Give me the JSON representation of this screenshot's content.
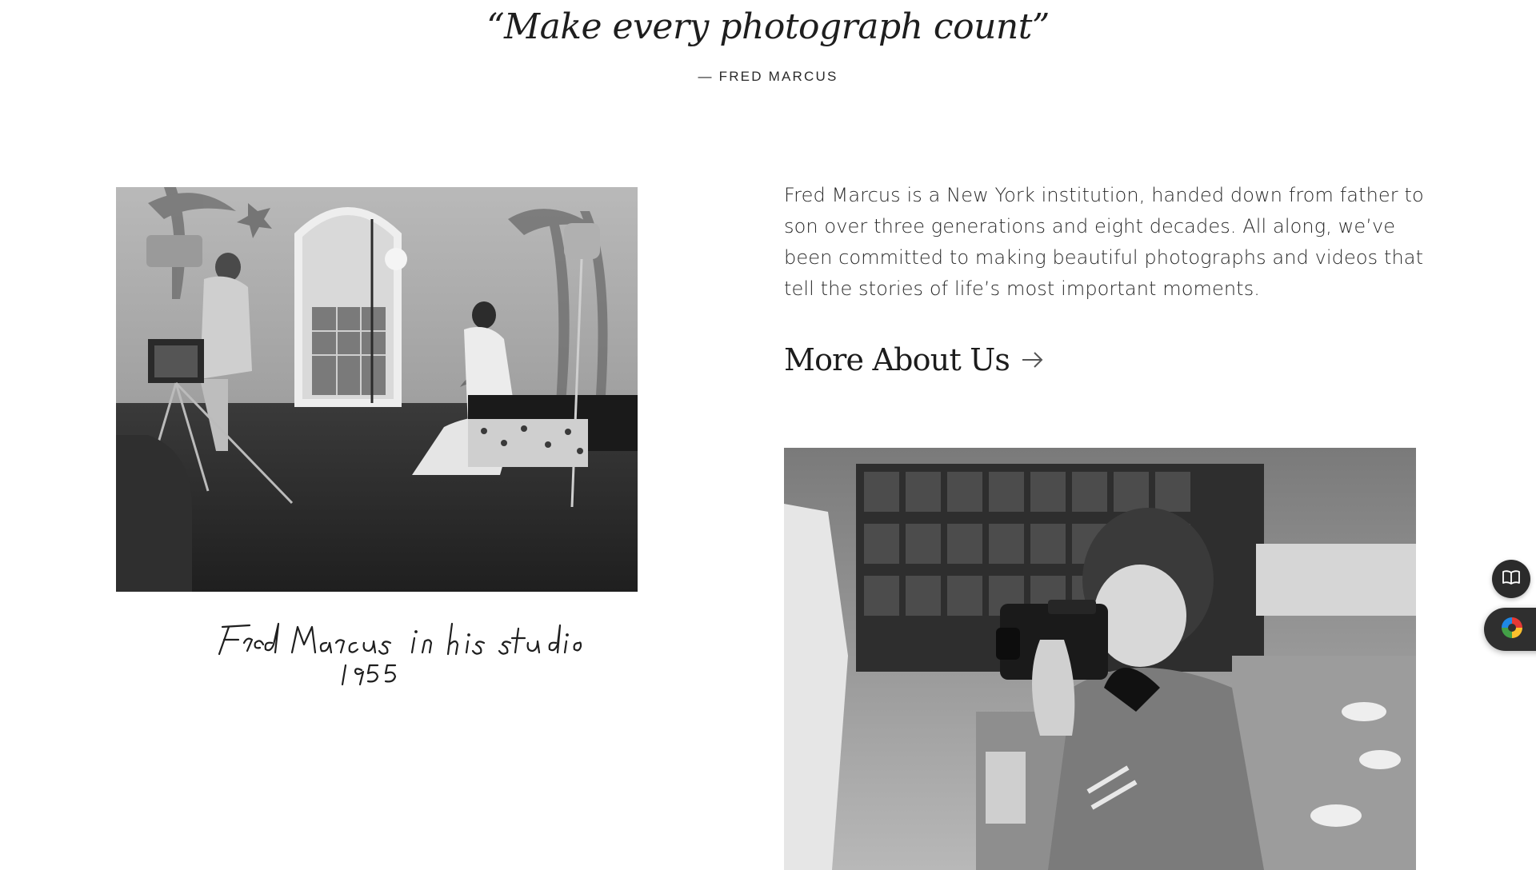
{
  "quote": {
    "text": "“Make every photograph count”",
    "author": "— FRED MARCUS"
  },
  "photo_left": {
    "caption_handwritten": "Fred Marcus in his studio 1955"
  },
  "intro": {
    "paragraph": "Fred Marcus is a New York institution, handed down from father to son over three generations and eight decades. All along, we’ve been committed to making beautiful photographs and videos that tell the stories of life’s most important moments."
  },
  "more_link": {
    "label": "More About Us",
    "icon": "arrow-right-icon"
  },
  "widgets": {
    "book_icon": "book-open-icon",
    "tab_icon": "color-wheel-icon"
  }
}
